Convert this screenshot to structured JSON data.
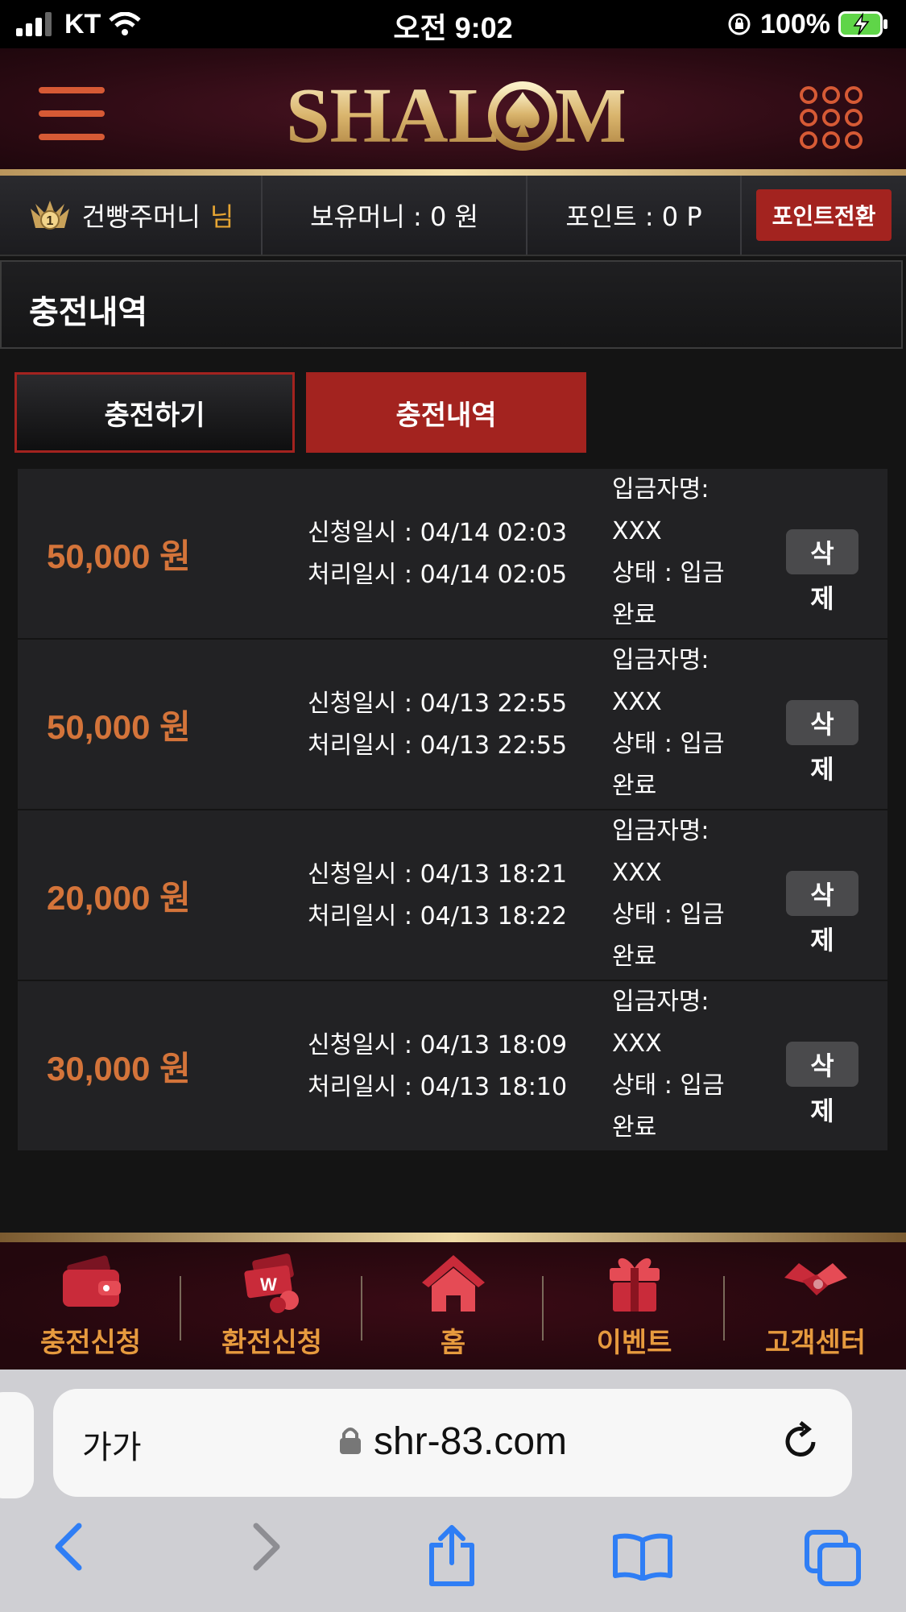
{
  "status_bar": {
    "carrier": "KT",
    "time": "오전 9:02",
    "battery": "100%"
  },
  "header": {
    "logo_text": "SHALOM"
  },
  "user_bar": {
    "username": "건빵주머니",
    "honorific": "님",
    "level_badge": "1",
    "money": "보유머니 : 0 원",
    "points": "포인트 : 0 P",
    "convert_label": "포인트전환"
  },
  "page_title": "충전내역",
  "tabs": [
    {
      "label": "충전하기"
    },
    {
      "label": "충전내역"
    }
  ],
  "history": [
    {
      "amount": "50,000 원",
      "requested": "신청일시 : 04/14 02:03",
      "processed": "처리일시 : 04/14 02:05",
      "depositor_label": "입금자명:",
      "depositor": "XXX",
      "status_a": "상태 : 입금",
      "status_b": "완료",
      "delete_a": "삭",
      "delete_b": "제"
    },
    {
      "amount": "50,000 원",
      "requested": "신청일시 : 04/13 22:55",
      "processed": "처리일시 : 04/13 22:55",
      "depositor_label": "입금자명:",
      "depositor": "XXX",
      "status_a": "상태 : 입금",
      "status_b": "완료",
      "delete_a": "삭",
      "delete_b": "제"
    },
    {
      "amount": "20,000 원",
      "requested": "신청일시 : 04/13 18:21",
      "processed": "처리일시 : 04/13 18:22",
      "depositor_label": "입금자명:",
      "depositor": "XXX",
      "status_a": "상태 : 입금",
      "status_b": "완료",
      "delete_a": "삭",
      "delete_b": "제"
    },
    {
      "amount": "30,000 원",
      "requested": "신청일시 : 04/13 18:09",
      "processed": "처리일시 : 04/13 18:10",
      "depositor_label": "입금자명:",
      "depositor": "XXX",
      "status_a": "상태 : 입금",
      "status_b": "완료",
      "delete_a": "삭",
      "delete_b": "제"
    }
  ],
  "bottom_nav": [
    {
      "label": "충전신청",
      "icon": "wallet-icon"
    },
    {
      "label": "환전신청",
      "icon": "money-icon"
    },
    {
      "label": "홈",
      "icon": "home-icon"
    },
    {
      "label": "이벤트",
      "icon": "gift-icon"
    },
    {
      "label": "고객센터",
      "icon": "handshake-icon"
    }
  ],
  "browser": {
    "text_size": "가가",
    "url": "shr-83.com"
  },
  "colors": {
    "accent_red": "#a3231f",
    "amount_orange": "#d4743a",
    "nav_label": "#e69a3e",
    "gold": "#e6a533"
  }
}
